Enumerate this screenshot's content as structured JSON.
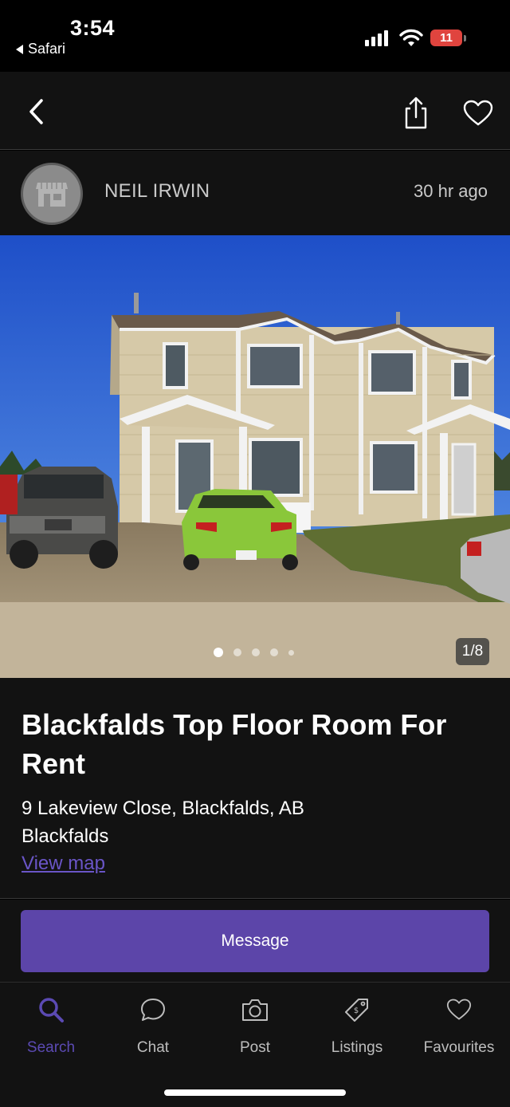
{
  "status_bar": {
    "time": "3:54",
    "back_app": "Safari",
    "battery": "11"
  },
  "nav": {
    "back_icon": "chevron-left-icon",
    "share_icon": "share-icon",
    "favourite_icon": "heart-icon"
  },
  "seller": {
    "name": "NEIL IRWIN",
    "posted": "30 hr  ago",
    "avatar_icon": "storefront-icon"
  },
  "gallery": {
    "counter": "1/8",
    "current_index": 1,
    "total": 8
  },
  "listing": {
    "title": "Blackfalds Top Floor Room For Rent",
    "address": "9 Lakeview Close, Blackfalds, AB",
    "city": "Blackfalds",
    "view_map": "View map"
  },
  "actions": {
    "message": "Message"
  },
  "tabs": [
    {
      "label": "Search",
      "icon": "search-icon",
      "active": true
    },
    {
      "label": "Chat",
      "icon": "chat-bubble-icon",
      "active": false
    },
    {
      "label": "Post",
      "icon": "camera-icon",
      "active": false
    },
    {
      "label": "Listings",
      "icon": "tag-icon",
      "active": false
    },
    {
      "label": "Favourites",
      "icon": "heart-icon",
      "active": false
    }
  ],
  "colors": {
    "accent": "#5c45a9",
    "link": "#6a55c7",
    "background": "#121212"
  }
}
